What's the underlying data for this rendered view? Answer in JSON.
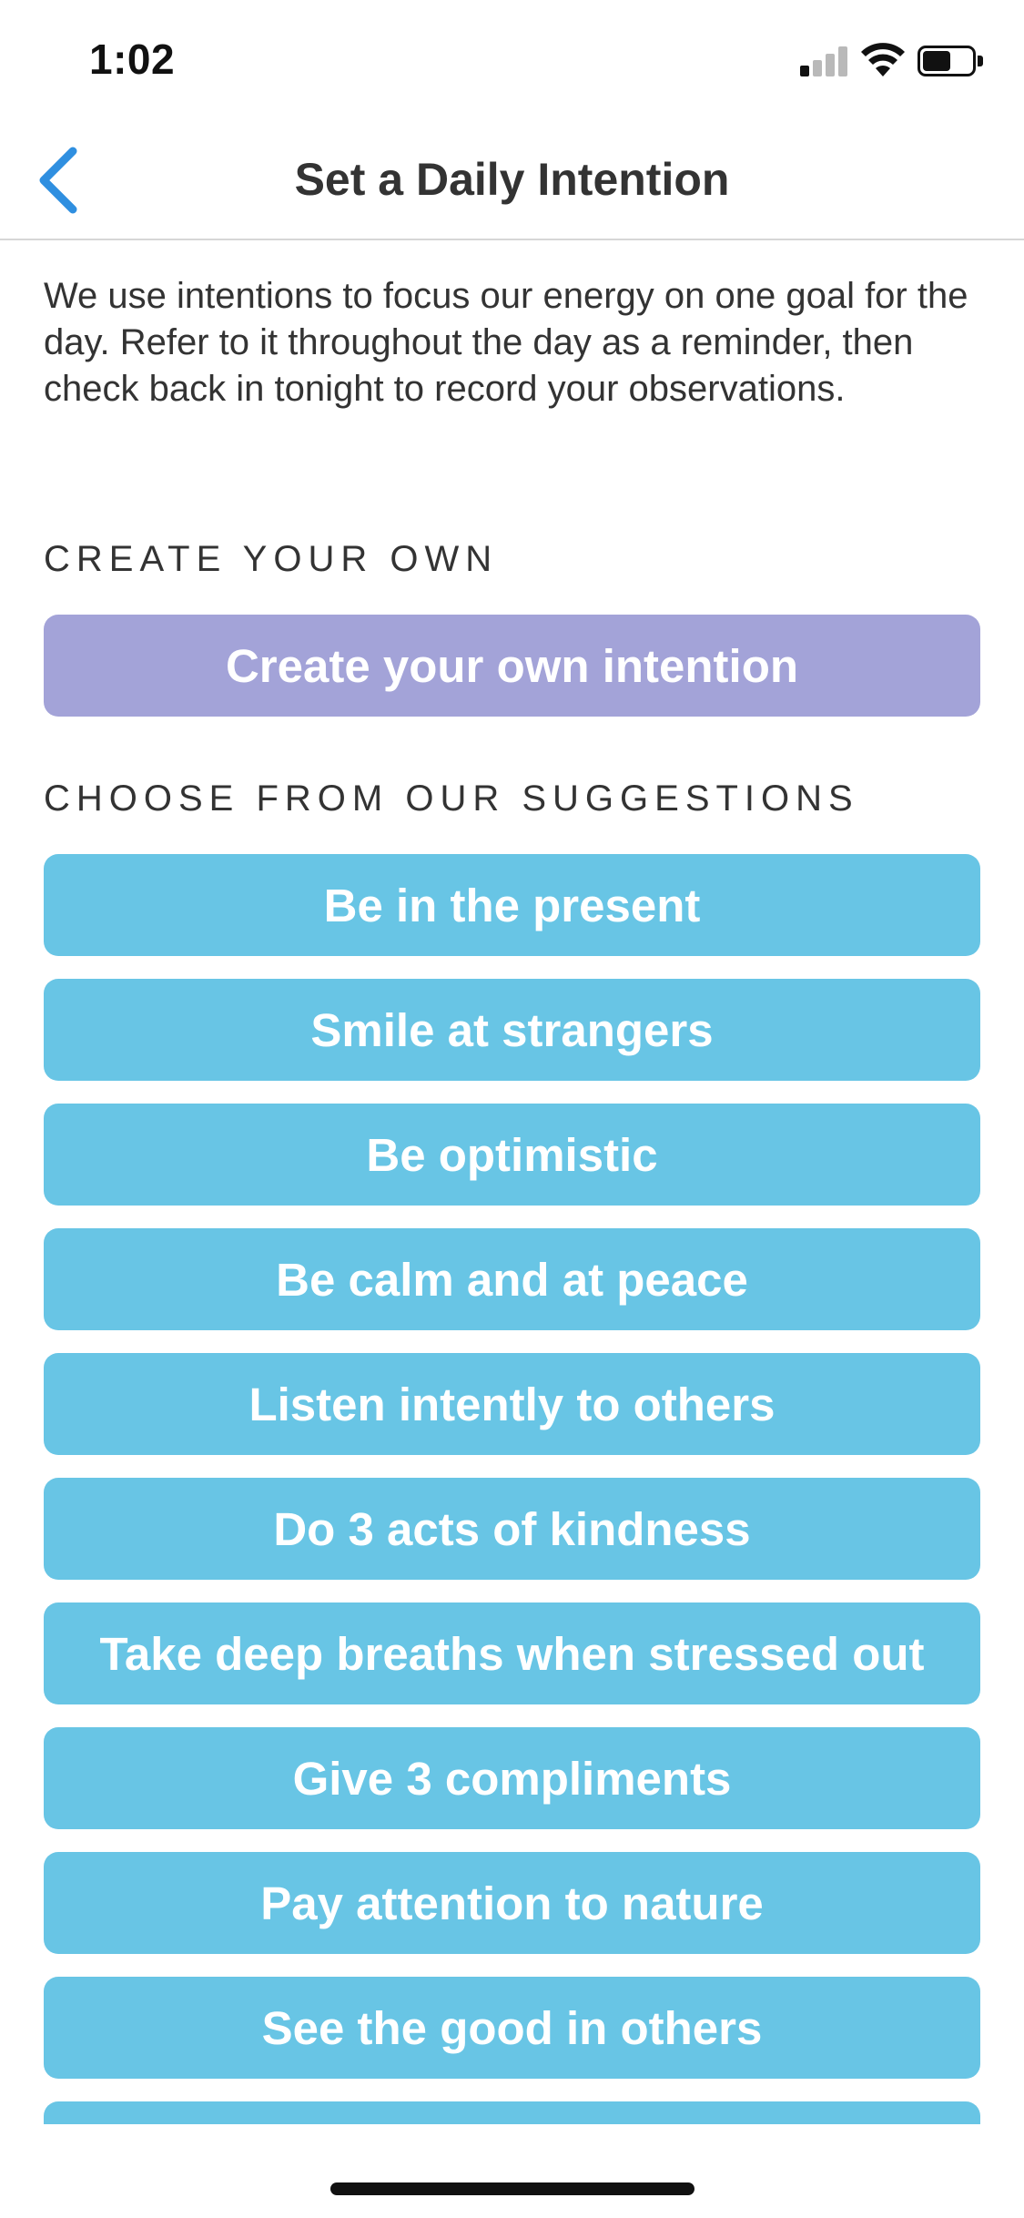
{
  "status_bar": {
    "time": "1:02",
    "icons": [
      "cellular-signal-icon",
      "wifi-icon",
      "battery-icon"
    ],
    "signal_bars_active": 1,
    "signal_bars_total": 4,
    "battery_level": 0.5
  },
  "nav": {
    "back_icon": "chevron-left-icon",
    "title": "Set a Daily Intention",
    "accent_color": "#2f8fe0"
  },
  "description": "We use intentions to focus our energy on one goal for the day. Refer to it throughout the day as a reminder, then check back in tonight to record your observations.",
  "create_section": {
    "label": "CREATE YOUR OWN",
    "button_label": "Create your own intention",
    "button_color": "#a3a3d8"
  },
  "suggestions_section": {
    "label": "CHOOSE FROM OUR SUGGESTIONS",
    "button_color": "#68c5e5",
    "items": [
      "Be in the present",
      "Smile at strangers",
      "Be optimistic",
      "Be calm and at peace",
      "Listen intently to others",
      "Do 3 acts of kindness",
      "Take deep breaths when stressed out",
      "Give 3 compliments",
      "Pay attention to nature",
      "See the good in others",
      ""
    ]
  }
}
